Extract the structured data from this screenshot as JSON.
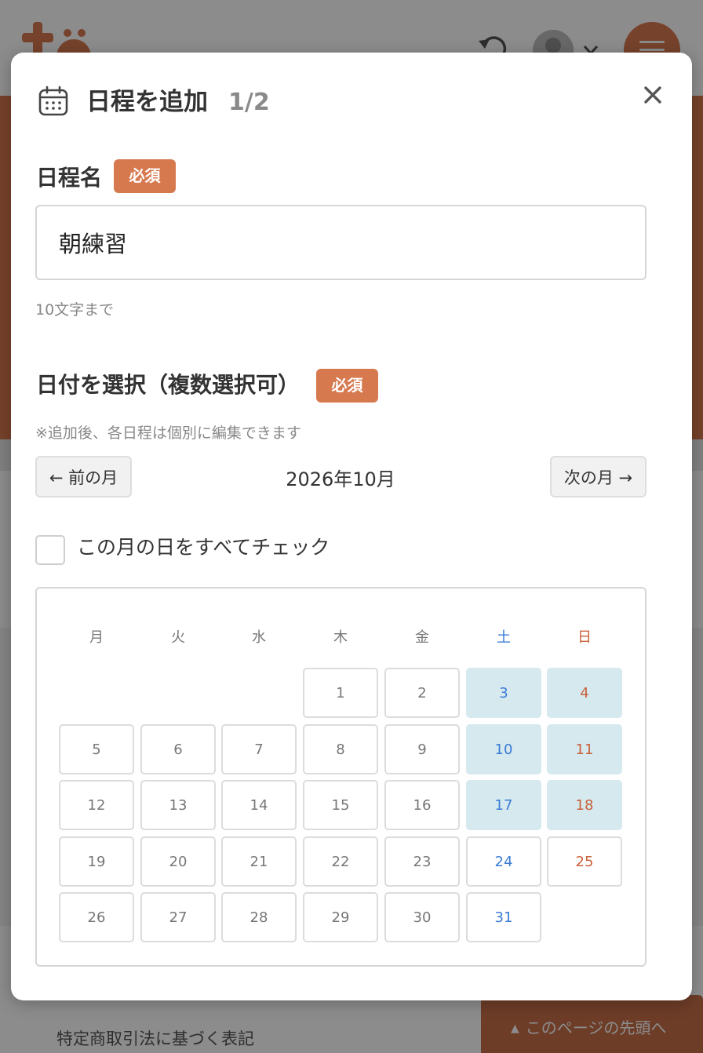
{
  "footer": {
    "link": "特定商取引法に基づく表記",
    "to_top": "このページの先頭へ"
  },
  "modal": {
    "title": "日程を追加",
    "step": "1/2",
    "name_field": {
      "label": "日程名",
      "required_badge": "必須",
      "value": "朝練習",
      "hint": "10文字まで"
    },
    "date_field": {
      "label": "日付を選択（複数選択可）",
      "required_badge": "必須",
      "note": "※追加後、各日程は個別に編集できます"
    },
    "calendar": {
      "prev_label": "← 前の月",
      "next_label": "次の月 →",
      "month_title": "2026年10月",
      "check_all_label": "この月の日をすべてチェック",
      "check_all_checked": false,
      "weekdays": [
        "月",
        "火",
        "水",
        "木",
        "金",
        "土",
        "日"
      ],
      "first_weekday_index": 3,
      "days_in_month": 31,
      "highlighted_days": [
        3,
        4,
        10,
        11,
        17,
        18
      ]
    }
  },
  "colors": {
    "accent": "#d7794f",
    "saturday": "#3a7bd5",
    "sunday": "#c9603a",
    "highlight": "#d6e9ef"
  },
  "icons": {
    "title": "calendar-icon",
    "close": "close-icon"
  }
}
